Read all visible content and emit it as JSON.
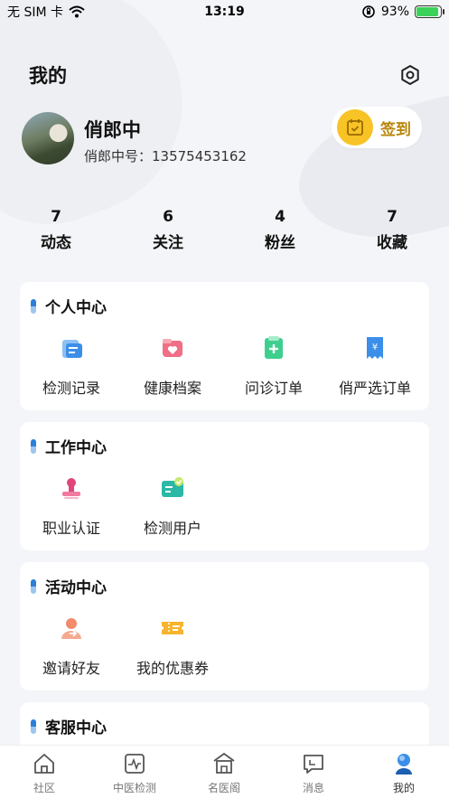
{
  "status_bar": {
    "carrier": "无 SIM 卡",
    "time": "13:19",
    "battery_percent": "93%",
    "battery_level": 0.93
  },
  "header": {
    "title": "我的"
  },
  "profile": {
    "name": "俏郎中",
    "id_text": "俏郎中号：13575453162",
    "checkin_label": "签到"
  },
  "stats": [
    {
      "value": "7",
      "label": "动态"
    },
    {
      "value": "6",
      "label": "关注"
    },
    {
      "value": "4",
      "label": "粉丝"
    },
    {
      "value": "7",
      "label": "收藏"
    }
  ],
  "personal_center": {
    "title": "个人中心",
    "items": [
      {
        "label": "检测记录",
        "icon": "test-record-icon"
      },
      {
        "label": "健康档案",
        "icon": "health-file-icon"
      },
      {
        "label": "问诊订单",
        "icon": "consult-order-icon"
      },
      {
        "label": "俏严选订单",
        "icon": "shop-order-icon"
      }
    ]
  },
  "work_center": {
    "title": "工作中心",
    "items": [
      {
        "label": "职业认证",
        "icon": "certification-icon"
      },
      {
        "label": "检测用户",
        "icon": "test-user-icon"
      }
    ]
  },
  "activity_center": {
    "title": "活动中心",
    "items": [
      {
        "label": "邀请好友",
        "icon": "invite-friend-icon"
      },
      {
        "label": "我的优惠券",
        "icon": "coupon-icon"
      }
    ]
  },
  "service_center": {
    "title": "客服中心"
  },
  "tabbar": {
    "tabs": [
      {
        "label": "社区",
        "icon": "home-icon"
      },
      {
        "label": "中医检测",
        "icon": "pulse-icon"
      },
      {
        "label": "名医阁",
        "icon": "pavilion-icon"
      },
      {
        "label": "消息",
        "icon": "message-icon"
      },
      {
        "label": "我的",
        "icon": "profile-icon"
      }
    ],
    "active_index": 4
  },
  "colors": {
    "accent_blue": "#2c7fd8",
    "checkin_yellow": "#f7c325",
    "checkin_text": "#b8860b",
    "background": "#f4f5f8"
  }
}
